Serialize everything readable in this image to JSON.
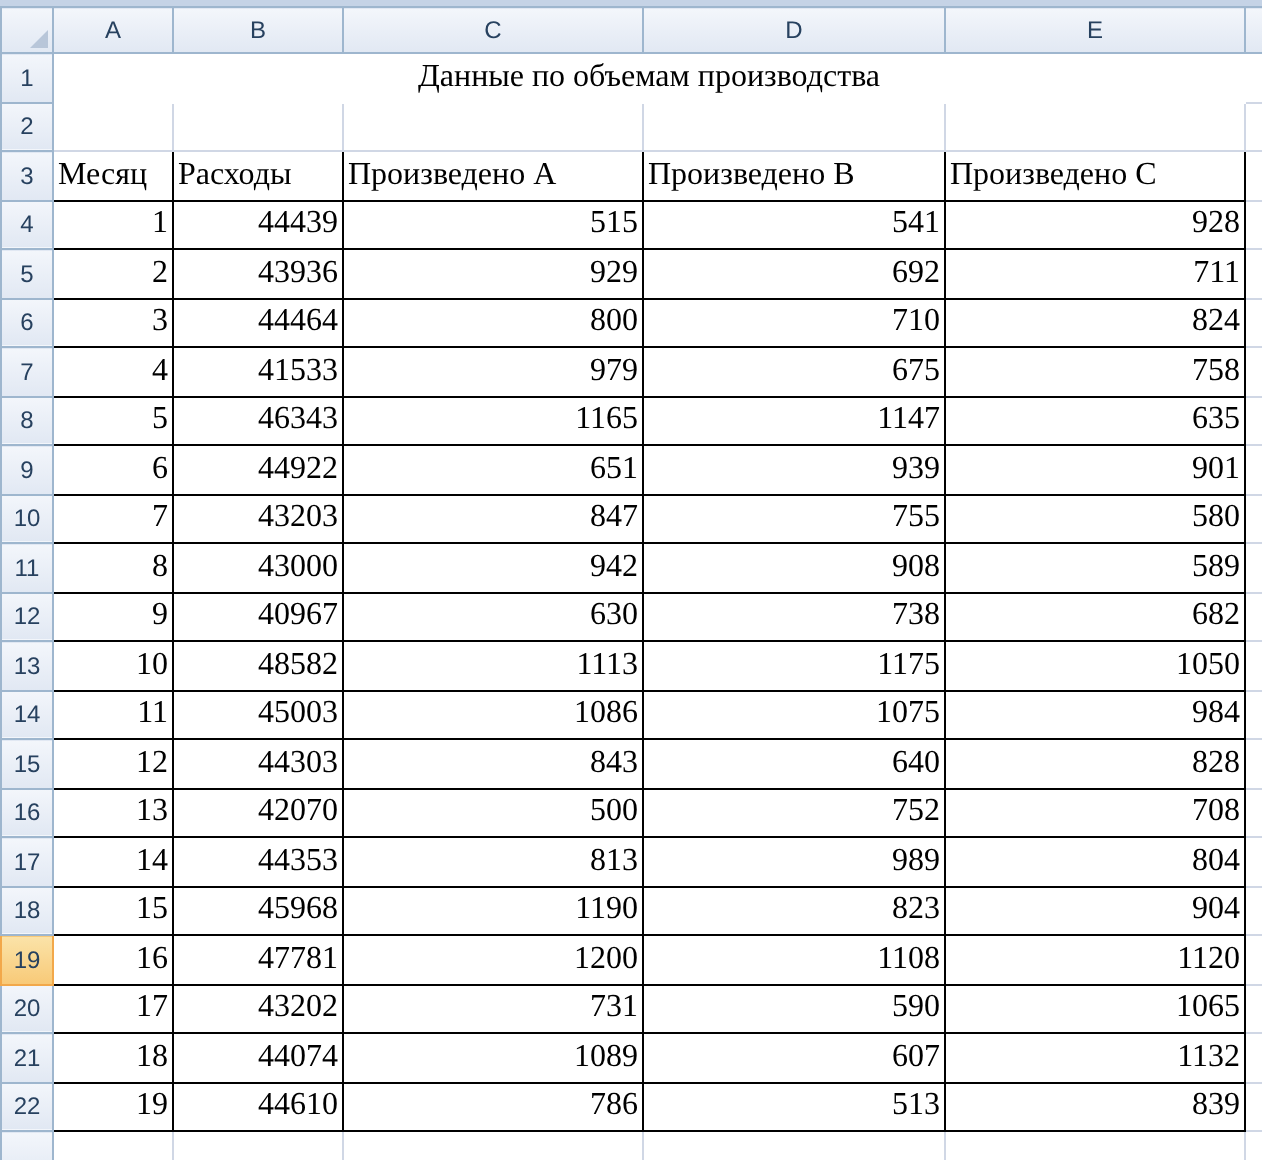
{
  "column_headers": [
    "A",
    "B",
    "C",
    "D",
    "E"
  ],
  "row_headers": [
    {
      "label": "1",
      "selected": false
    },
    {
      "label": "2",
      "selected": false
    },
    {
      "label": "3",
      "selected": false
    },
    {
      "label": "4",
      "selected": false
    },
    {
      "label": "5",
      "selected": false
    },
    {
      "label": "6",
      "selected": false
    },
    {
      "label": "7",
      "selected": false
    },
    {
      "label": "8",
      "selected": false
    },
    {
      "label": "9",
      "selected": false
    },
    {
      "label": "10",
      "selected": false
    },
    {
      "label": "11",
      "selected": false
    },
    {
      "label": "12",
      "selected": false
    },
    {
      "label": "13",
      "selected": false
    },
    {
      "label": "14",
      "selected": false
    },
    {
      "label": "15",
      "selected": false
    },
    {
      "label": "16",
      "selected": false
    },
    {
      "label": "17",
      "selected": false
    },
    {
      "label": "18",
      "selected": false
    },
    {
      "label": "19",
      "selected": true
    },
    {
      "label": "20",
      "selected": false
    },
    {
      "label": "21",
      "selected": false
    },
    {
      "label": "22",
      "selected": false
    }
  ],
  "title": "Данные по объемам производства",
  "table": {
    "columns": [
      "Месяц",
      "Расходы",
      "Произведено A",
      "Произведено B",
      "Произведено C"
    ],
    "rows": [
      [
        "1",
        "44439",
        "515",
        "541",
        "928"
      ],
      [
        "2",
        "43936",
        "929",
        "692",
        "711"
      ],
      [
        "3",
        "44464",
        "800",
        "710",
        "824"
      ],
      [
        "4",
        "41533",
        "979",
        "675",
        "758"
      ],
      [
        "5",
        "46343",
        "1165",
        "1147",
        "635"
      ],
      [
        "6",
        "44922",
        "651",
        "939",
        "901"
      ],
      [
        "7",
        "43203",
        "847",
        "755",
        "580"
      ],
      [
        "8",
        "43000",
        "942",
        "908",
        "589"
      ],
      [
        "9",
        "40967",
        "630",
        "738",
        "682"
      ],
      [
        "10",
        "48582",
        "1113",
        "1175",
        "1050"
      ],
      [
        "11",
        "45003",
        "1086",
        "1075",
        "984"
      ],
      [
        "12",
        "44303",
        "843",
        "640",
        "828"
      ],
      [
        "13",
        "42070",
        "500",
        "752",
        "708"
      ],
      [
        "14",
        "44353",
        "813",
        "989",
        "804"
      ],
      [
        "15",
        "45968",
        "1190",
        "823",
        "904"
      ],
      [
        "16",
        "47781",
        "1200",
        "1108",
        "1120"
      ],
      [
        "17",
        "43202",
        "731",
        "590",
        "1065"
      ],
      [
        "18",
        "44074",
        "1089",
        "607",
        "1132"
      ],
      [
        "19",
        "44610",
        "786",
        "513",
        "839"
      ]
    ]
  }
}
